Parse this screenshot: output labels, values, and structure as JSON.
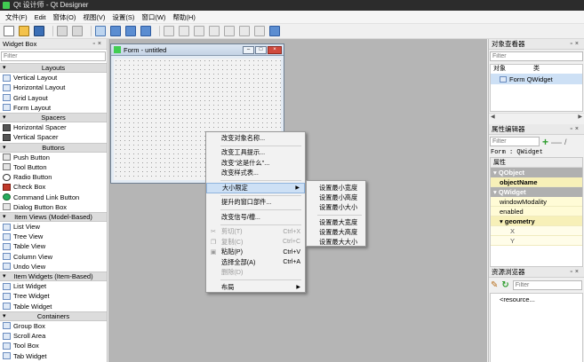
{
  "window": {
    "title": "Qt 设计师 - Qt Designer"
  },
  "menu": [
    "文件(F)",
    "Edit",
    "窗体(O)",
    "视图(V)",
    "设置(S)",
    "窗口(W)",
    "帮助(H)"
  ],
  "widget_box": {
    "title": "Widget Box",
    "filter_placeholder": "Filter",
    "categories": {
      "layouts": "Layouts",
      "spacers": "Spacers",
      "buttons": "Buttons",
      "item_views": "Item Views (Model-Based)",
      "item_widgets": "Item Widgets (Item-Based)",
      "containers": "Containers"
    },
    "items": {
      "vertical_layout": "Vertical Layout",
      "horizontal_layout": "Horizontal Layout",
      "grid_layout": "Grid Layout",
      "form_layout": "Form Layout",
      "horizontal_spacer": "Horizontal Spacer",
      "vertical_spacer": "Vertical Spacer",
      "push_button": "Push Button",
      "tool_button": "Tool Button",
      "radio_button": "Radio Button",
      "check_box": "Check Box",
      "command_link_button": "Command Link Button",
      "dialog_button_box": "Dialog Button Box",
      "list_view": "List View",
      "tree_view": "Tree View",
      "table_view": "Table View",
      "column_view": "Column View",
      "undo_view": "Undo View",
      "list_widget": "List Widget",
      "tree_widget": "Tree Widget",
      "table_widget": "Table Widget",
      "group_box": "Group Box",
      "scroll_area": "Scroll Area",
      "tool_box": "Tool Box",
      "tab_widget": "Tab Widget"
    }
  },
  "form": {
    "title": "Form - untitled"
  },
  "context_menu": {
    "change_object_name": "改变对象名称...",
    "change_tooltip": "改变工具提示...",
    "change_whats_this": "改变\"这是什么\"...",
    "change_stylesheet": "改变样式表...",
    "size_constraints": "大小限定",
    "promote_to": "提升的窗口部件...",
    "change_signals": "改变信号/槽...",
    "cut": "剪切(T)",
    "cut_sc": "Ctrl+X",
    "copy": "复制(C)",
    "copy_sc": "Ctrl+C",
    "paste": "粘贴(P)",
    "paste_sc": "Ctrl+V",
    "select_all": "选择全部(A)",
    "select_all_sc": "Ctrl+A",
    "delete": "删除(D)",
    "layout": "布局"
  },
  "submenu": {
    "min_width": "设置最小宽度",
    "min_height": "设置最小高度",
    "min_size": "设置最小大小",
    "max_width": "设置最大宽度",
    "max_height": "设置最大高度",
    "max_size": "设置最大大小"
  },
  "object_inspector": {
    "title": "对象查看器",
    "filter_placeholder": "Filter",
    "col_object": "对象",
    "col_class": "类",
    "row": "Form QWidget"
  },
  "property_editor": {
    "title": "属性编辑器",
    "filter_placeholder": "Filter",
    "class_line": "Form : QWidget",
    "header": "属性",
    "groups": {
      "qobject": "QObject",
      "qwidget": "QWidget"
    },
    "rows": {
      "object_name": "objectName",
      "window_modality": "windowModality",
      "enabled": "enabled",
      "geometry": "geometry",
      "x": "X",
      "y": "Y"
    }
  },
  "resource_browser": {
    "title": "资源浏览器",
    "filter_placeholder": "Filter",
    "root": "<resource..."
  }
}
